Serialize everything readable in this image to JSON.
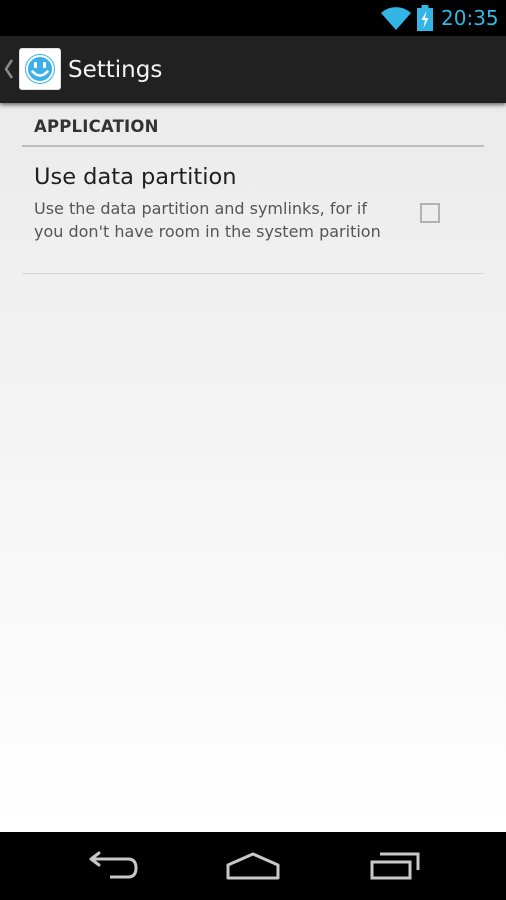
{
  "status_bar": {
    "time": "20:35",
    "icons": [
      "wifi-icon",
      "battery-charging-icon"
    ],
    "accent_color": "#33b5e5"
  },
  "action_bar": {
    "title": "Settings",
    "app_icon": "smiley-icon",
    "up_icon": "chevron-left-icon"
  },
  "preferences": {
    "category": "APPLICATION",
    "items": [
      {
        "title": "Use data partition",
        "summary": "Use the data partition and symlinks, for if you don't have room in the system parition",
        "checked": false
      }
    ]
  },
  "navigation_bar": {
    "buttons": [
      "back-icon",
      "home-icon",
      "recents-icon"
    ]
  }
}
